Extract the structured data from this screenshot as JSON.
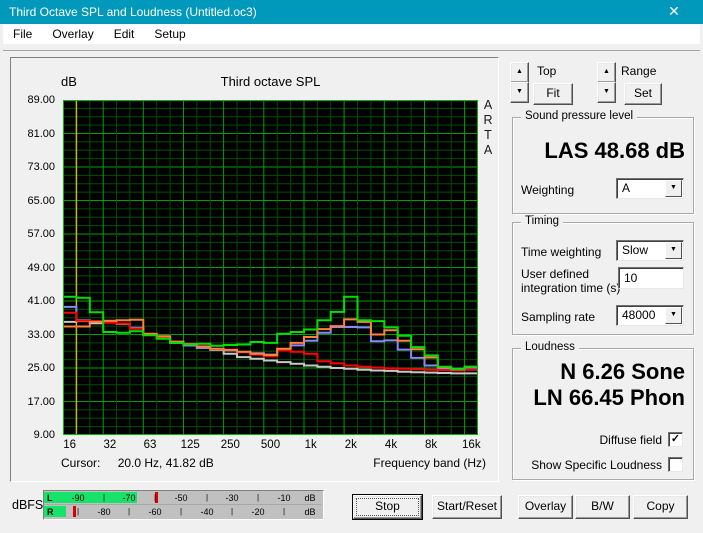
{
  "window": {
    "title": "Third Octave SPL and Loudness (Untitled.oc3)"
  },
  "icons": {
    "close": "✕",
    "up": "▲",
    "down": "▼",
    "dropdown": "▼",
    "check": "✓"
  },
  "menu": {
    "items": [
      "File",
      "Overlay",
      "Edit",
      "Setup"
    ]
  },
  "chart_panel": {
    "y_unit": "dB",
    "title": "Third octave SPL",
    "watermark": "ARTA",
    "cursor_label": "Cursor:",
    "cursor_value": "20.0 Hz, 41.82 dB",
    "x_axis_label": "Frequency band (Hz)"
  },
  "chart_data": {
    "type": "line",
    "subtype": "third-octave-step",
    "title": "Third octave SPL",
    "ylabel": "dB",
    "xlabel": "Frequency band (Hz)",
    "ylim": [
      9,
      89
    ],
    "y_ticks": [
      "89.00",
      "81.00",
      "73.00",
      "65.00",
      "57.00",
      "49.00",
      "41.00",
      "33.00",
      "25.00",
      "17.00",
      "9.00"
    ],
    "x_ticks": [
      "16",
      "32",
      "63",
      "125",
      "250",
      "500",
      "1k",
      "2k",
      "4k",
      "8k",
      "16k"
    ],
    "bands": [
      "16",
      "20",
      "25",
      "31.5",
      "40",
      "50",
      "63",
      "80",
      "100",
      "125",
      "160",
      "200",
      "250",
      "315",
      "400",
      "500",
      "630",
      "800",
      "1k",
      "1.25k",
      "1.6k",
      "2k",
      "2.5k",
      "3.15k",
      "4k",
      "5k",
      "6.3k",
      "8k",
      "10k",
      "12.5k",
      "16k"
    ],
    "cursor": {
      "freq_hz": 20.0,
      "value_db": 41.82
    },
    "grid": {
      "bg": "#000000",
      "minor": "#004d00",
      "major": "#00a000",
      "frame": "#00b400",
      "cursor_color": "#c8b800"
    },
    "legend_visible": false,
    "series": [
      {
        "name": "gray",
        "color": "#c8c8c8",
        "values": [
          36.0,
          36.2,
          35.7,
          35.9,
          35.5,
          34.4,
          33.0,
          32.2,
          31.0,
          30.4,
          29.8,
          29.3,
          28.4,
          27.6,
          27.2,
          26.8,
          26.4,
          26.0,
          25.6,
          25.3,
          25.0,
          24.8,
          24.6,
          24.4,
          24.3,
          24.1,
          24.0,
          23.9,
          23.8,
          23.7,
          23.7
        ]
      },
      {
        "name": "blue",
        "color": "#8888ff",
        "values": [
          39.6,
          36.4,
          36.0,
          36.2,
          35.6,
          34.6,
          33.0,
          32.2,
          31.0,
          30.4,
          29.9,
          29.5,
          29.2,
          28.8,
          28.5,
          28.2,
          29.4,
          30.4,
          31.5,
          33.4,
          34.8,
          34.8,
          34.7,
          31.4,
          31.6,
          29.4,
          27.4,
          25.6,
          24.9,
          24.8,
          25.1
        ]
      },
      {
        "name": "red",
        "color": "#ff0000",
        "values": [
          38.2,
          36.3,
          36.2,
          35.8,
          35.6,
          34.4,
          33.1,
          32.4,
          31.2,
          30.8,
          30.2,
          29.5,
          29.4,
          28.8,
          28.2,
          27.8,
          29.2,
          28.9,
          28.4,
          26.6,
          26.1,
          25.6,
          25.3,
          25.1,
          24.9,
          24.8,
          24.7,
          24.6,
          24.5,
          24.4,
          24.6
        ]
      },
      {
        "name": "orange",
        "color": "#ff8040",
        "values": [
          34.9,
          34.9,
          36.0,
          36.3,
          36.4,
          36.5,
          33.2,
          32.6,
          31.3,
          30.7,
          30.1,
          29.6,
          29.3,
          28.9,
          28.4,
          28.1,
          29.6,
          31.0,
          32.4,
          34.3,
          35.0,
          36.6,
          36.0,
          33.0,
          34.0,
          31.5,
          29.5,
          27.5,
          25.2,
          24.7,
          25.3
        ]
      },
      {
        "name": "green",
        "color": "#00e000",
        "values": [
          42.0,
          41.8,
          38.3,
          33.6,
          33.4,
          33.8,
          32.8,
          32.0,
          31.0,
          30.6,
          30.8,
          30.3,
          30.5,
          30.6,
          31.2,
          31.0,
          33.2,
          33.6,
          34.2,
          36.4,
          38.4,
          42.0,
          36.4,
          36.2,
          34.7,
          32.7,
          30.0,
          28.0,
          25.3,
          24.7,
          25.3
        ]
      }
    ]
  },
  "controls": {
    "top_label": "Top",
    "fit_button": "Fit",
    "range_label": "Range",
    "set_button": "Set"
  },
  "spl_group": {
    "legend": "Sound pressure level",
    "value": "LAS 48.68 dB",
    "weighting_label": "Weighting",
    "weighting_value": "A"
  },
  "timing_group": {
    "legend": "Timing",
    "time_weighting_label": "Time weighting",
    "time_weighting_value": "Slow",
    "integration_label_line1": "User defined",
    "integration_label_line2": "integration time (s)",
    "integration_value": "10",
    "sampling_label": "Sampling rate",
    "sampling_value": "48000"
  },
  "loudness_group": {
    "legend": "Loudness",
    "n_value": "N 6.26 Sone",
    "ln_value": "LN 66.45 Phon",
    "diffuse_label": "Diffuse field",
    "diffuse_checked": true,
    "specific_label": "Show Specific Loudness",
    "specific_checked": false
  },
  "meter": {
    "label": "dBFS",
    "unit": "dB",
    "rows": [
      {
        "channel": "L",
        "level_dbfs": -67,
        "peak_dbfs": -60,
        "labels": [
          -90,
          -70,
          -50,
          -30,
          -10
        ],
        "ticks": [
          -80,
          -60,
          -40,
          -20
        ]
      },
      {
        "channel": "R",
        "level_dbfs": -94.5,
        "peak_dbfs": -92,
        "labels": [
          -80,
          -60,
          -40,
          -20
        ],
        "ticks": [
          -90,
          -70,
          -50,
          -30,
          -10
        ]
      }
    ]
  },
  "buttons": {
    "stop": "Stop",
    "start_reset": "Start/Reset",
    "overlay": "Overlay",
    "bw": "B/W",
    "copy": "Copy"
  }
}
